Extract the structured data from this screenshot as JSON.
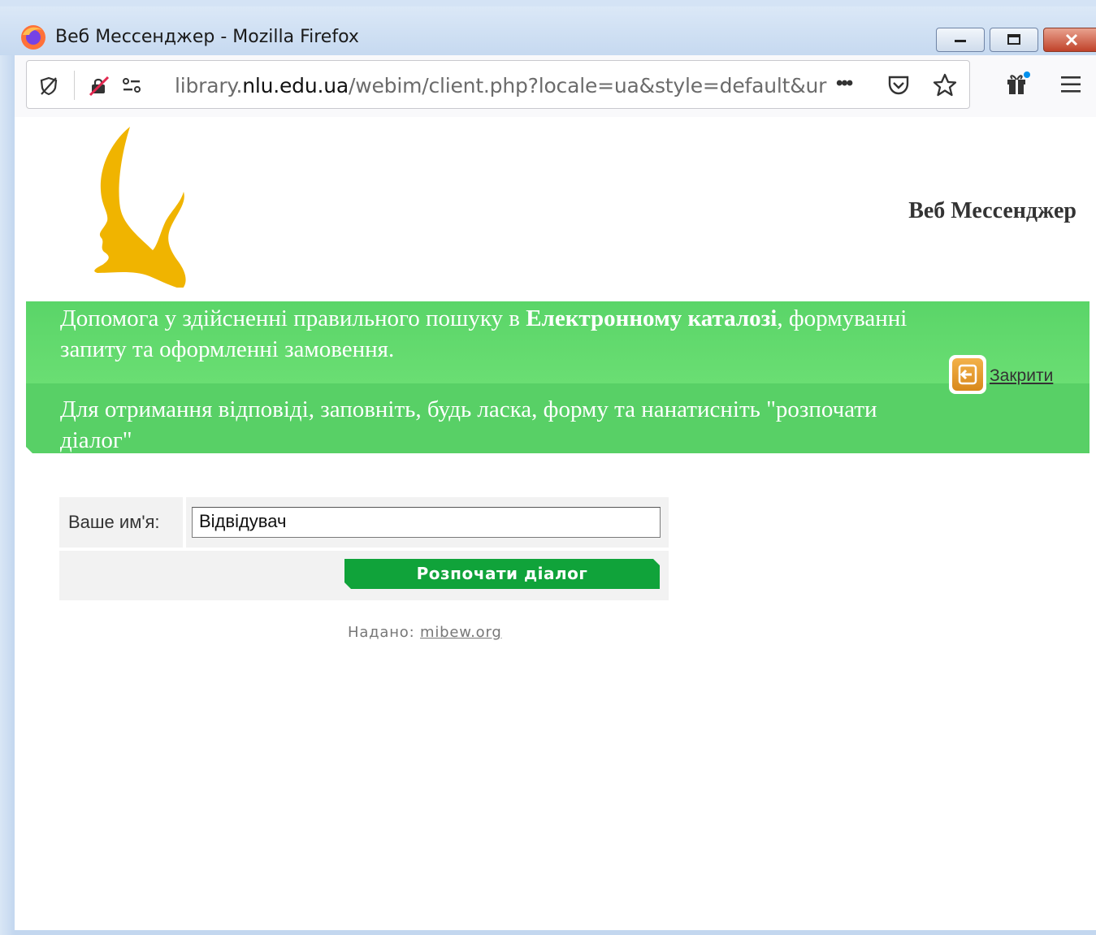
{
  "window": {
    "title": "Веб Мессенджер - Mozilla Firefox"
  },
  "urlbar": {
    "url_prefix": "library.",
    "url_host": "nlu.edu.ua",
    "url_rest": "/webim/client.php?locale=ua&style=default&ur",
    "overflow": "•••"
  },
  "header": {
    "title": "Веб Мессенджер"
  },
  "banner": {
    "line1_part1": "Допомога у здійсненні правильного пошуку в ",
    "line1_bold": "Електронному каталозі",
    "line1_part2": ", формуванні запиту та оформленні замовення.",
    "line2": "Для отримання відповіді, заповніть, будь ласка, форму та нанатисніть \"розпочати діалог\"",
    "close_label": "Закрити"
  },
  "form": {
    "name_label": "Ваше им'я:",
    "name_value": "Відвідувач",
    "start_button": "Розпочати діалог"
  },
  "footer": {
    "prefix": "Надано: ",
    "link": "mibew.org"
  },
  "colors": {
    "banner_green": "#5ad568",
    "button_green": "#10a33a",
    "logo_gold": "#f0b400"
  }
}
